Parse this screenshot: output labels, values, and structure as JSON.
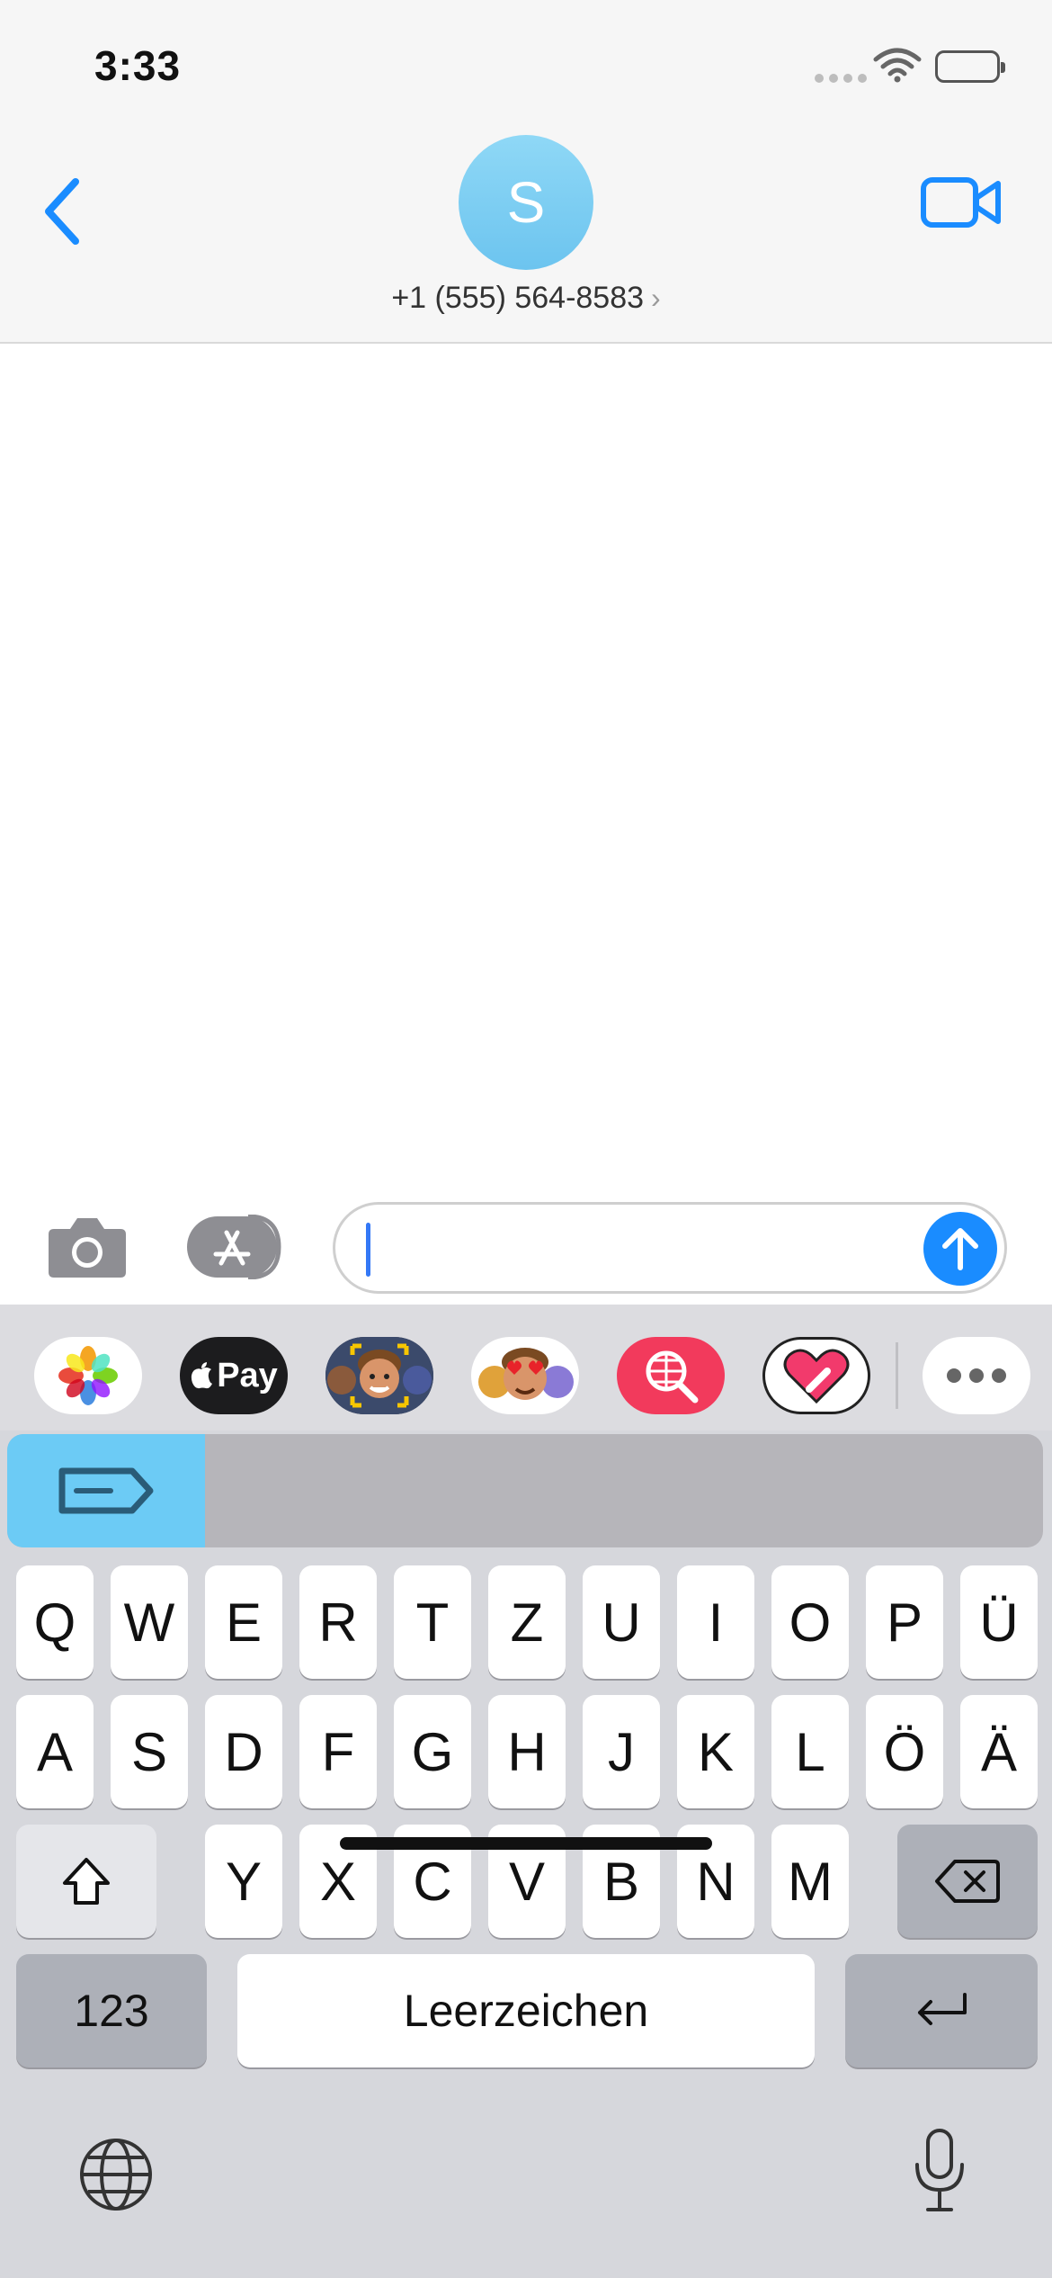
{
  "status_bar": {
    "time": "3:33"
  },
  "header": {
    "avatar_initial": "S",
    "contact_number": "+1 (555) 564-8583",
    "contact_chevron": "›"
  },
  "compose": {
    "text_value": "",
    "camera_icon": "camera-icon",
    "appstore_icon": "app-store-icon",
    "send_icon": "arrow-up-icon"
  },
  "app_strip": [
    {
      "name": "photos",
      "icon": "photos-icon"
    },
    {
      "name": "apple-pay",
      "label": "Pay"
    },
    {
      "name": "memoji-camera",
      "icon": "memoji-icon"
    },
    {
      "name": "memoji-stickers",
      "icon": "memoji-sticker-icon"
    },
    {
      "name": "web-images",
      "icon": "globe-search-icon"
    },
    {
      "name": "digital-touch",
      "icon": "heart-icon"
    },
    {
      "name": "more",
      "icon": "more-icon"
    }
  ],
  "keyboard": {
    "row1": [
      "Q",
      "W",
      "E",
      "R",
      "T",
      "Z",
      "U",
      "I",
      "O",
      "P",
      "Ü"
    ],
    "row2": [
      "A",
      "S",
      "D",
      "F",
      "G",
      "H",
      "J",
      "K",
      "L",
      "Ö",
      "Ä"
    ],
    "row3": [
      "Y",
      "X",
      "C",
      "V",
      "B",
      "N",
      "M"
    ],
    "numbers_label": "123",
    "space_label": "Leerzeichen",
    "colors": {
      "key_bg": "#ffffff",
      "accent": "#1a8cff",
      "avatar": "#7ccbf2"
    }
  }
}
